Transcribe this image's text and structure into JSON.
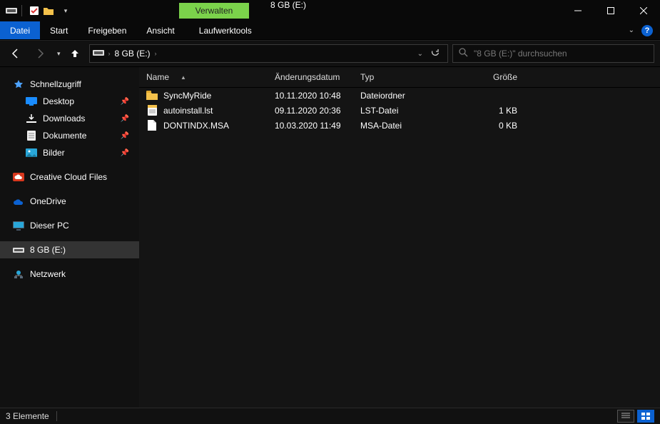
{
  "title": "8 GB (E:)",
  "manage_label": "Verwalten",
  "ribbon": {
    "file": "Datei",
    "start": "Start",
    "share": "Freigeben",
    "view": "Ansicht",
    "drive": "Laufwerktools"
  },
  "address": {
    "root_icon": "drive",
    "crumb1": "8 GB (E:)"
  },
  "search": {
    "placeholder": "\"8 GB (E:)\" durchsuchen"
  },
  "nav": {
    "quick": "Schnellzugriff",
    "desktop": "Desktop",
    "downloads": "Downloads",
    "documents": "Dokumente",
    "pictures": "Bilder",
    "ccf": "Creative Cloud Files",
    "onedrive": "OneDrive",
    "thispc": "Dieser PC",
    "drive": "8 GB (E:)",
    "network": "Netzwerk"
  },
  "columns": {
    "name": "Name",
    "date": "Änderungsdatum",
    "type": "Typ",
    "size": "Größe"
  },
  "rows": [
    {
      "icon": "folder",
      "name": "SyncMyRide",
      "date": "10.11.2020 10:48",
      "type": "Dateiordner",
      "size": ""
    },
    {
      "icon": "lst",
      "name": "autoinstall.lst",
      "date": "09.11.2020 20:36",
      "type": "LST-Datei",
      "size": "1 KB"
    },
    {
      "icon": "file",
      "name": "DONTINDX.MSA",
      "date": "10.03.2020 11:49",
      "type": "MSA-Datei",
      "size": "0 KB"
    }
  ],
  "status": {
    "count": "3 Elemente"
  }
}
